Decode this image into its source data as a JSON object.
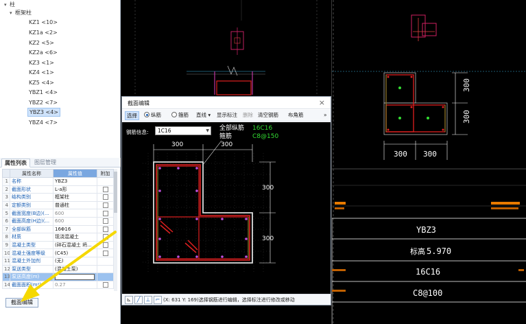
{
  "tree": {
    "root_label": "柱",
    "group_label": "框架柱",
    "items": [
      {
        "label": "KZ1 <10>"
      },
      {
        "label": "KZ1a <2>"
      },
      {
        "label": "KZ2 <5>"
      },
      {
        "label": "KZ2a <6>"
      },
      {
        "label": "KZ3 <1>"
      },
      {
        "label": "KZ4 <1>"
      },
      {
        "label": "KZ5 <4>"
      },
      {
        "label": "YBZ1 <4>"
      },
      {
        "label": "YBZ2 <7>"
      },
      {
        "label": "YBZ3 <4>"
      },
      {
        "label": "YBZ4 <7>"
      }
    ],
    "selected": "YBZ3 <4>"
  },
  "prop_tabs": {
    "active": "属性列表",
    "inactive": "图层管理"
  },
  "prop_table": {
    "headers": [
      "属性名称",
      "属性值",
      "附加"
    ],
    "rows": [
      {
        "num": "1",
        "name": "名称",
        "value": "YBZ3",
        "gray": false,
        "check": false
      },
      {
        "num": "2",
        "name": "截面形状",
        "value": "L-a形",
        "gray": false,
        "check": true
      },
      {
        "num": "3",
        "name": "结构类别",
        "value": "框架柱",
        "gray": false,
        "check": true
      },
      {
        "num": "4",
        "name": "定额类别",
        "value": "普通柱",
        "gray": false,
        "check": true
      },
      {
        "num": "5",
        "name": "截面宽度(B边)(...",
        "value": "600",
        "gray": true,
        "check": true
      },
      {
        "num": "6",
        "name": "截面高度(H边)(...",
        "value": "600",
        "gray": true,
        "check": true
      },
      {
        "num": "7",
        "name": "全部纵筋",
        "value": "16Φ16",
        "gray": false,
        "check": true
      },
      {
        "num": "8",
        "name": "材质",
        "value": "现浇混凝土",
        "gray": false,
        "check": true
      },
      {
        "num": "9",
        "name": "混凝土类型",
        "value": "(碎石混凝土 坍...",
        "gray": false,
        "check": true
      },
      {
        "num": "10",
        "name": "混凝土强度等级",
        "value": "(C45)",
        "gray": false,
        "check": true
      },
      {
        "num": "11",
        "name": "混凝土外加剂",
        "value": "(无)",
        "gray": false,
        "check": false
      },
      {
        "num": "12",
        "name": "泵送类型",
        "value": "(混凝土泵)",
        "gray": false,
        "check": false
      },
      {
        "num": "13",
        "name": "泵送高度(m)",
        "value": "",
        "gray": false,
        "check": false,
        "selected": true
      },
      {
        "num": "14",
        "name": "截面面积(m²)",
        "value": "0.27",
        "gray": true,
        "check": true
      }
    ]
  },
  "section_edit_button": "截面编辑",
  "dialog": {
    "title": "截面编辑",
    "close": "×",
    "toolbar": {
      "select": "选择",
      "longitudinal": "纵筋",
      "stirrup": "箍筋",
      "line": "直线",
      "show_label": "显示标注",
      "delete": "删除",
      "clear": "清空钢筋",
      "corner": "布角筋",
      "more": "»"
    },
    "rebar_info_label": "钢筋信息:",
    "rebar_info_value": "1C16",
    "annotation_all_long": "全部纵筋",
    "annotation_all_long_value": "16C16",
    "annotation_stirrup": "箍筋",
    "annotation_stirrup_value": "C8@150",
    "dim_top_left": "300",
    "dim_top_right": "300",
    "dim_right_top": "300",
    "dim_right_bottom": "300",
    "status_text": "(X: 631 Y: 169)选择钢筋进行编辑，选择标注进行修改或移动"
  },
  "right_canvas": {
    "dim_left": "300",
    "dim_right": "300",
    "dim_upper": "300",
    "dim_lower": "300",
    "table_name": "YBZ3",
    "table_elevation": "5.970",
    "table_elevation_prefix": "标高",
    "table_long_rebar": "16C16",
    "table_stirrup": "C8@100"
  },
  "colors": {
    "selection": "#cfe3fb",
    "header_highlight": "#7aa7e0",
    "rebar_red": "#e02020",
    "concrete_white": "#ffffff",
    "annotation_green": "#33dd33",
    "arrow_yellow": "#f5d800"
  }
}
